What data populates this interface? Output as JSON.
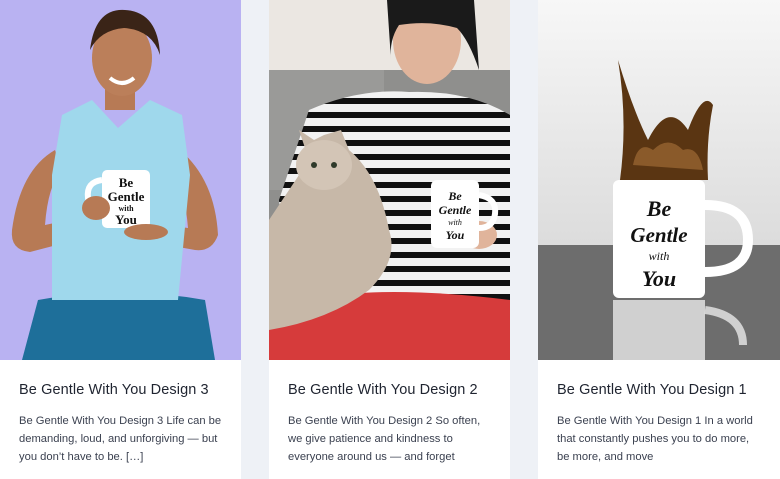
{
  "posts": [
    {
      "title": "Be Gentle With You Design 3",
      "excerpt": "Be Gentle With You Design 3 Life can be demanding, loud, and unforgiving — but you don’t have to be. […]",
      "mug_text": [
        "Be",
        "Gentle",
        "with",
        "You"
      ],
      "background": "#b9b2f2"
    },
    {
      "title": "Be Gentle With You Design 2",
      "excerpt": "Be Gentle With You Design 2 So often, we give patience and kindness to everyone around us — and forget",
      "mug_text": [
        "Be",
        "Gentle",
        "with",
        "You"
      ],
      "background": "#e7e3df"
    },
    {
      "title": "Be Gentle With You Design 1",
      "excerpt": "Be Gentle With You Design 1 In a world that constantly pushes you to do more, be more, and move",
      "mug_text": [
        "Be",
        "Gentle",
        "with",
        "You"
      ],
      "background": "#f4f4f4"
    }
  ]
}
